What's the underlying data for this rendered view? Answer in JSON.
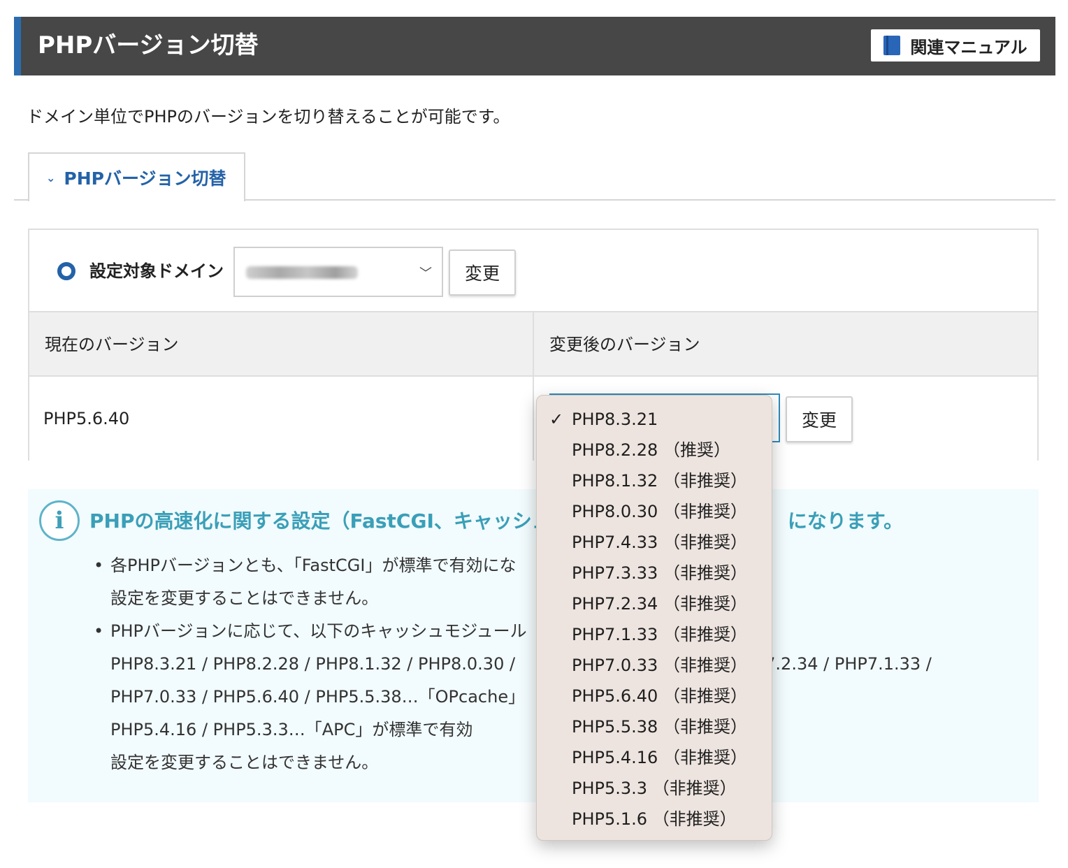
{
  "header": {
    "title": "PHPバージョン切替",
    "manual_label": "関連マニュアル"
  },
  "intro": "ドメイン単位でPHPのバージョンを切り替えることが可能です。",
  "tab": {
    "label": "PHPバージョン切替"
  },
  "domain": {
    "label": "設定対象ドメイン",
    "change_label": "変更"
  },
  "table": {
    "headers": [
      "現在のバージョン",
      "変更後のバージョン"
    ],
    "current_version": "PHP5.6.40",
    "change_label": "変更"
  },
  "info": {
    "title": "PHPの高速化に関する設定（FastCGI、キャッシュ",
    "title_tail": "になります。",
    "bullets": [
      "各PHPバージョンとも、「FastCGI」が標準で有効にな",
      "設定を変更することはできません。",
      "PHPバージョンに応じて、以下のキャッシュモジュール",
      "PHP8.3.21 / PHP8.2.28 / PHP8.1.32 / PHP8.0.30 / ",
      "P7.2.34 / PHP7.1.33 /",
      "PHP7.0.33 / PHP5.6.40 / PHP5.5.38…「OPcache」",
      "PHP5.4.16 / PHP5.3.3…「APC」が標準で有効",
      "設定を変更することはできません。"
    ]
  },
  "dropdown": {
    "check": "✓",
    "options": [
      "PHP8.3.21",
      "PHP8.2.28 （推奨）",
      "PHP8.1.32 （非推奨）",
      "PHP8.0.30 （非推奨）",
      "PHP7.4.33 （非推奨）",
      "PHP7.3.33 （非推奨）",
      "PHP7.2.34 （非推奨）",
      "PHP7.1.33 （非推奨）",
      "PHP7.0.33 （非推奨）",
      "PHP5.6.40 （非推奨）",
      "PHP5.5.38 （非推奨）",
      "PHP5.4.16 （非推奨）",
      "PHP5.3.3 （非推奨）",
      "PHP5.1.6 （非推奨）"
    ]
  }
}
